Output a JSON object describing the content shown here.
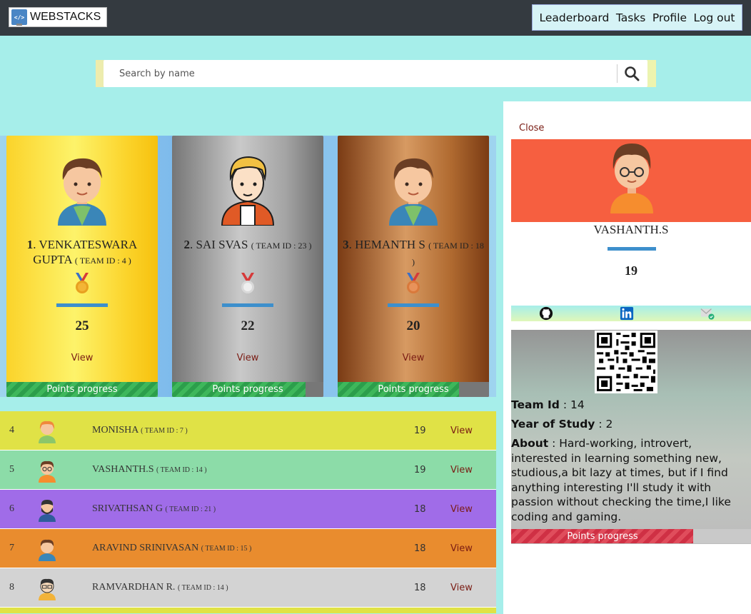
{
  "nav": {
    "brand": "WEBSTACKS",
    "brand_icon": "monitor-code-icon",
    "links": [
      "Leaderboard",
      "Tasks",
      "Profile",
      "Log out"
    ]
  },
  "search": {
    "placeholder": "Search by name",
    "icon": "search-icon"
  },
  "top3": [
    {
      "rank": "1",
      "name": "VENKATESWARA GUPTA",
      "team": "( TEAM ID : 4 )",
      "points": "25",
      "view": "View",
      "progress_label": "Points progress",
      "progress": 1.0,
      "medal": "gold-medal-icon",
      "medal_color": "#e8a020"
    },
    {
      "rank": "2",
      "name": "SAI SVAS",
      "team": "( TEAM ID : 23 )",
      "points": "22",
      "view": "View",
      "progress_label": "Points progress",
      "progress": 0.88,
      "medal": "silver-medal-icon",
      "medal_color": "#d9d9d9"
    },
    {
      "rank": "3",
      "name": "HEMANTH S",
      "team": "( TEAM ID : 18 )",
      "points": "20",
      "view": "View",
      "progress_label": "Points progress",
      "progress": 0.8,
      "medal": "bronze-medal-icon",
      "medal_color": "#d9793b"
    }
  ],
  "list": [
    {
      "rank": "4",
      "name": "MONISHA",
      "team": "( TEAM ID : 7 )",
      "points": "19",
      "view": "View",
      "bg": "#e0e246"
    },
    {
      "rank": "5",
      "name": "VASHANTH.S",
      "team": "( TEAM ID : 14 )",
      "points": "19",
      "view": "View",
      "bg": "#8cdca8"
    },
    {
      "rank": "6",
      "name": "SRIVATHSAN G",
      "team": "( TEAM ID : 21 )",
      "points": "18",
      "view": "View",
      "bg": "#a06ce8"
    },
    {
      "rank": "7",
      "name": "ARAVIND SRINIVASAN",
      "team": "( TEAM ID : 15 )",
      "points": "18",
      "view": "View",
      "bg": "#e98c2e"
    },
    {
      "rank": "8",
      "name": "RAMVARDHAN R.",
      "team": "( TEAM ID : 14 )",
      "points": "18",
      "view": "View",
      "bg": "#d3d3d3"
    }
  ],
  "panel": {
    "close": "Close",
    "name": "VASHANTH.S",
    "points": "19",
    "socials": [
      "github-icon",
      "linkedin-icon",
      "mail-verified-icon"
    ],
    "team_label": "Team Id",
    "team_value": " : 14",
    "year_label": "Year of Study",
    "year_value": " : 2",
    "about_label": "About",
    "about_value": " : Hard-working, introvert, interested in learning something new, studious,a bit lazy at times, but if I find anything interesting I'll study it with passion without checking the time,I like coding and gaming.",
    "progress_label": "Points progress",
    "progress": 0.76
  }
}
